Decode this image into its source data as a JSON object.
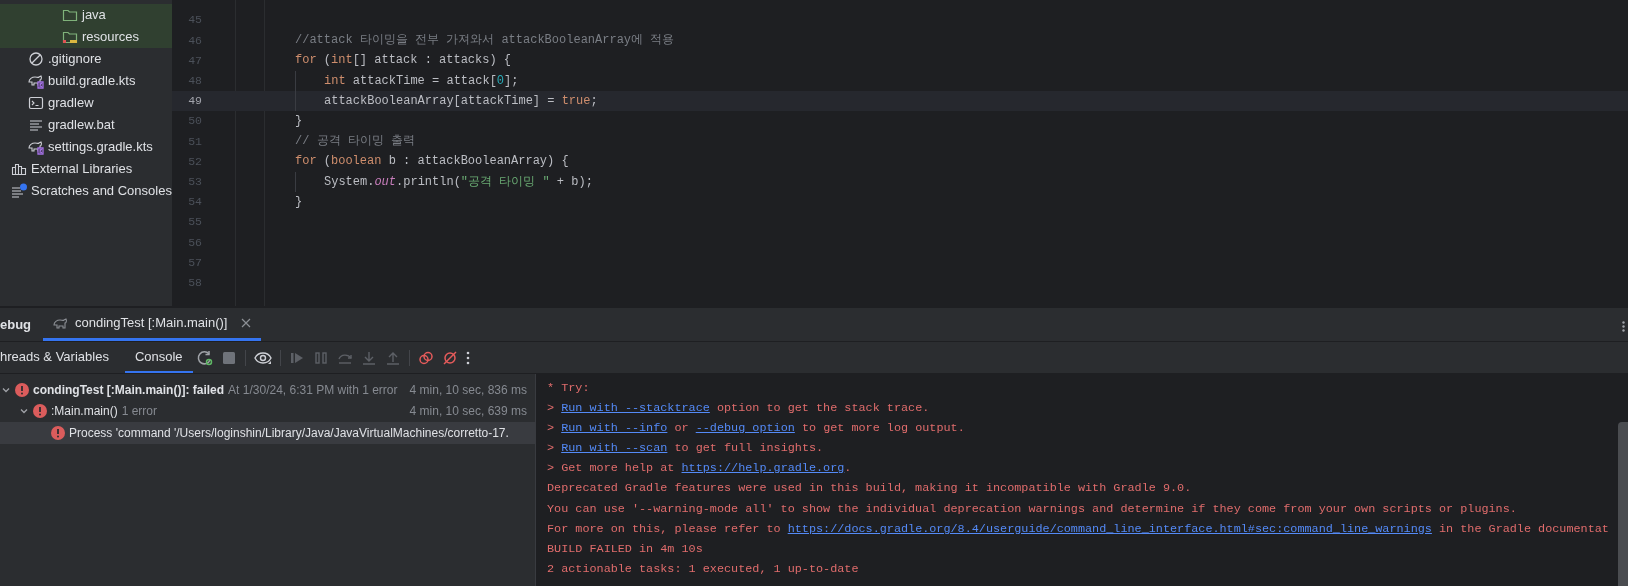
{
  "project_tree": [
    {
      "children": [
        {
          "children": [
            {
              "children": [
                {
                  "label": "java",
                  "kind": "folder",
                  "highlighted": true
                },
                {
                  "label": "resources",
                  "kind": "resource-folder",
                  "highlighted": true
                }
              ]
            }
          ]
        },
        {
          "label": ".gitignore",
          "kind": "ignore-file",
          "highlighted": false
        },
        {
          "label": "build.gradle.kts",
          "kind": "gradle-script",
          "highlighted": false
        },
        {
          "label": "gradlew",
          "kind": "shell-script",
          "highlighted": false
        },
        {
          "label": "gradlew.bat",
          "kind": "text-file",
          "highlighted": false
        },
        {
          "label": "settings.gradle.kts",
          "kind": "gradle-script",
          "highlighted": false
        }
      ]
    },
    {
      "label": "External Libraries",
      "kind": "libraries",
      "highlighted": false
    },
    {
      "label": "Scratches and Consoles",
      "kind": "scratches",
      "highlighted": false
    }
  ],
  "editor": {
    "lines": [
      {
        "number": "45",
        "current": false
      },
      {
        "number": "46",
        "current": false,
        "segments": [
          {
            "kind": "comment",
            "text": "//attack 타이밍을 전부 가져와서 attackBooleanArray에 적용"
          }
        ]
      },
      {
        "number": "47",
        "current": false,
        "segments": [
          {
            "kind": "keyword",
            "text": "for"
          },
          {
            "kind": "plain",
            "text": " ("
          },
          {
            "kind": "keyword",
            "text": "int"
          },
          {
            "kind": "plain",
            "text": "[] attack : attacks) {"
          }
        ]
      },
      {
        "number": "48",
        "current": false,
        "inner": true,
        "segments": [
          {
            "kind": "keyword",
            "text": "int"
          },
          {
            "kind": "plain",
            "text": " attackTime = attack["
          },
          {
            "kind": "number",
            "text": "0"
          },
          {
            "kind": "plain",
            "text": "];"
          }
        ]
      },
      {
        "number": "49",
        "current": true,
        "inner": true,
        "segments": [
          {
            "kind": "plain",
            "text": "attackBooleanArray[attackTime] = "
          },
          {
            "kind": "keyword",
            "text": "true"
          },
          {
            "kind": "plain",
            "text": ";"
          }
        ]
      },
      {
        "number": "50",
        "current": false,
        "segments": [
          {
            "kind": "plain",
            "text": "}"
          }
        ]
      },
      {
        "number": "51",
        "current": false,
        "segments": [
          {
            "kind": "comment",
            "text": "// 공격 타이밍 출력"
          }
        ]
      },
      {
        "number": "52",
        "current": false,
        "segments": [
          {
            "kind": "keyword",
            "text": "for"
          },
          {
            "kind": "plain",
            "text": " ("
          },
          {
            "kind": "keyword",
            "text": "boolean"
          },
          {
            "kind": "plain",
            "text": " b : attackBooleanArray) {"
          }
        ]
      },
      {
        "number": "53",
        "current": false,
        "inner": true,
        "segments": [
          {
            "kind": "plain",
            "text": "System."
          },
          {
            "kind": "field",
            "text": "out"
          },
          {
            "kind": "plain",
            "text": ".println("
          },
          {
            "kind": "string",
            "text": "\"공격 타이밍 \""
          },
          {
            "kind": "plain",
            "text": " + b);"
          }
        ]
      },
      {
        "number": "54",
        "current": false,
        "segments": [
          {
            "kind": "plain",
            "text": "}"
          }
        ]
      },
      {
        "number": "55",
        "current": false
      },
      {
        "number": "56",
        "current": false
      },
      {
        "number": "57",
        "current": false
      },
      {
        "number": "58",
        "current": false
      }
    ]
  },
  "debug_panel": {
    "title": "ebug",
    "tabs": [
      {
        "label": "condingTest [:Main.main()]",
        "selected": true
      }
    ],
    "subtabs": [
      {
        "label": "hreads & Variables",
        "selected": false
      },
      {
        "label": "Console",
        "selected": true
      }
    ],
    "tree": [
      {
        "title": "condingTest [:Main.main()]: failed",
        "detail": "At 1/30/24, 6:31 PM with 1 error",
        "duration": "4 min, 10 sec, 836 ms",
        "expanded": true,
        "selected": false,
        "children": [
          {
            "title": ":Main.main()",
            "detail": "1 error",
            "duration": "4 min, 10 sec, 639 ms",
            "expanded": true,
            "selected": false,
            "children": [
              {
                "title": "Process 'command '/Users/loginshin/Library/Java/JavaVirtualMachines/corretto-17.",
                "selected": true
              }
            ]
          }
        ]
      }
    ],
    "console": [
      [
        {
          "kind": "text",
          "text": "* Try:"
        }
      ],
      [
        {
          "kind": "text",
          "text": "> "
        },
        {
          "kind": "link",
          "text": "Run with --stacktrace"
        },
        {
          "kind": "text",
          "text": " option to get the stack trace."
        }
      ],
      [
        {
          "kind": "text",
          "text": "> "
        },
        {
          "kind": "link",
          "text": "Run with --info"
        },
        {
          "kind": "text",
          "text": " or "
        },
        {
          "kind": "link",
          "text": "--debug option"
        },
        {
          "kind": "text",
          "text": " to get more log output."
        }
      ],
      [
        {
          "kind": "text",
          "text": "> "
        },
        {
          "kind": "link",
          "text": "Run with --scan"
        },
        {
          "kind": "text",
          "text": " to get full insights."
        }
      ],
      [
        {
          "kind": "text",
          "text": "> Get more help at "
        },
        {
          "kind": "link",
          "text": "https://help.gradle.org"
        },
        {
          "kind": "text",
          "text": "."
        }
      ],
      [
        {
          "kind": "text",
          "text": "Deprecated Gradle features were used in this build, making it incompatible with Gradle 9.0."
        }
      ],
      [
        {
          "kind": "text",
          "text": "You can use '--warning-mode all' to show the individual deprecation warnings and determine if they come from your own scripts or plugins."
        }
      ],
      [
        {
          "kind": "text",
          "text": "For more on this, please refer to "
        },
        {
          "kind": "link",
          "text": "https://docs.gradle.org/8.4/userguide/command_line_interface.html#sec:command_line_warnings"
        },
        {
          "kind": "text",
          "text": " in the Gradle documentat"
        }
      ],
      [
        {
          "kind": "text",
          "text": "BUILD FAILED in 4m 10s"
        }
      ],
      [
        {
          "kind": "text",
          "text": "2 actionable tasks: 1 executed, 1 up-to-date"
        }
      ]
    ]
  }
}
